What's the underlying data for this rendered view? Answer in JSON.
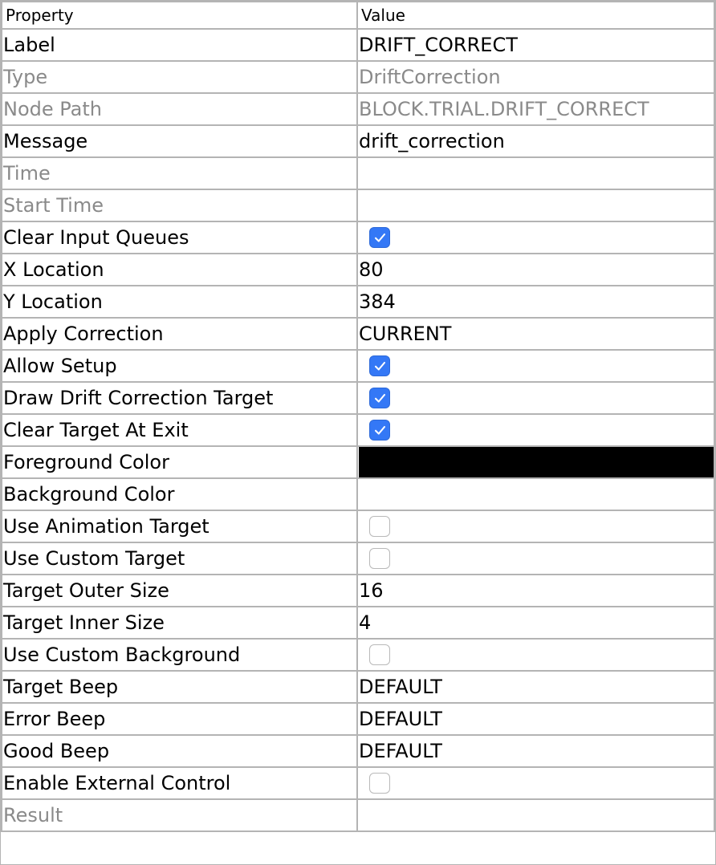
{
  "header": {
    "property_label": "Property",
    "value_label": "Value"
  },
  "rows": [
    {
      "name": "Label",
      "value": "DRIFT_CORRECT",
      "kind": "text",
      "readonly": false
    },
    {
      "name": "Type",
      "value": "DriftCorrection",
      "kind": "text",
      "readonly": true
    },
    {
      "name": "Node Path",
      "value": "BLOCK.TRIAL.DRIFT_CORRECT",
      "kind": "text",
      "readonly": true
    },
    {
      "name": "Message",
      "value": "drift_correction",
      "kind": "text",
      "readonly": false
    },
    {
      "name": "Time",
      "value": "",
      "kind": "text",
      "readonly": true
    },
    {
      "name": "Start Time",
      "value": "",
      "kind": "text",
      "readonly": true
    },
    {
      "name": "Clear Input Queues",
      "checked": true,
      "kind": "checkbox",
      "readonly": false
    },
    {
      "name": "X Location",
      "value": "80",
      "kind": "text",
      "readonly": false
    },
    {
      "name": "Y Location",
      "value": "384",
      "kind": "text",
      "readonly": false
    },
    {
      "name": "Apply Correction",
      "value": "CURRENT",
      "kind": "text",
      "readonly": false
    },
    {
      "name": "Allow Setup",
      "checked": true,
      "kind": "checkbox",
      "readonly": false
    },
    {
      "name": "Draw Drift Correction Target",
      "checked": true,
      "kind": "checkbox",
      "readonly": false
    },
    {
      "name": "Clear Target At Exit",
      "checked": true,
      "kind": "checkbox",
      "readonly": false
    },
    {
      "name": "Foreground Color",
      "color": "#000000",
      "kind": "color",
      "readonly": false
    },
    {
      "name": "Background Color",
      "color": "#ffffff",
      "kind": "color",
      "readonly": false
    },
    {
      "name": "Use Animation Target",
      "checked": false,
      "kind": "checkbox",
      "readonly": false
    },
    {
      "name": "Use Custom Target",
      "checked": false,
      "kind": "checkbox",
      "readonly": false
    },
    {
      "name": "Target Outer Size",
      "value": "16",
      "kind": "text",
      "readonly": false
    },
    {
      "name": "Target Inner Size",
      "value": "4",
      "kind": "text",
      "readonly": false
    },
    {
      "name": "Use Custom Background",
      "checked": false,
      "kind": "checkbox",
      "readonly": false
    },
    {
      "name": "Target Beep",
      "value": "DEFAULT",
      "kind": "text",
      "readonly": false
    },
    {
      "name": "Error Beep",
      "value": "DEFAULT",
      "kind": "text",
      "readonly": false
    },
    {
      "name": "Good Beep",
      "value": "DEFAULT",
      "kind": "text",
      "readonly": false
    },
    {
      "name": "Enable External Control",
      "checked": false,
      "kind": "checkbox",
      "readonly": false
    },
    {
      "name": "Result",
      "value": "",
      "kind": "text",
      "readonly": true
    }
  ],
  "colors": {
    "grid_line": "#b4b4b4",
    "readonly_text": "#8a8a8a",
    "checkbox_on": "#3478f6",
    "checkbox_off_border": "#b9b9b9"
  },
  "icons": {
    "checked": "checkmark-icon"
  }
}
